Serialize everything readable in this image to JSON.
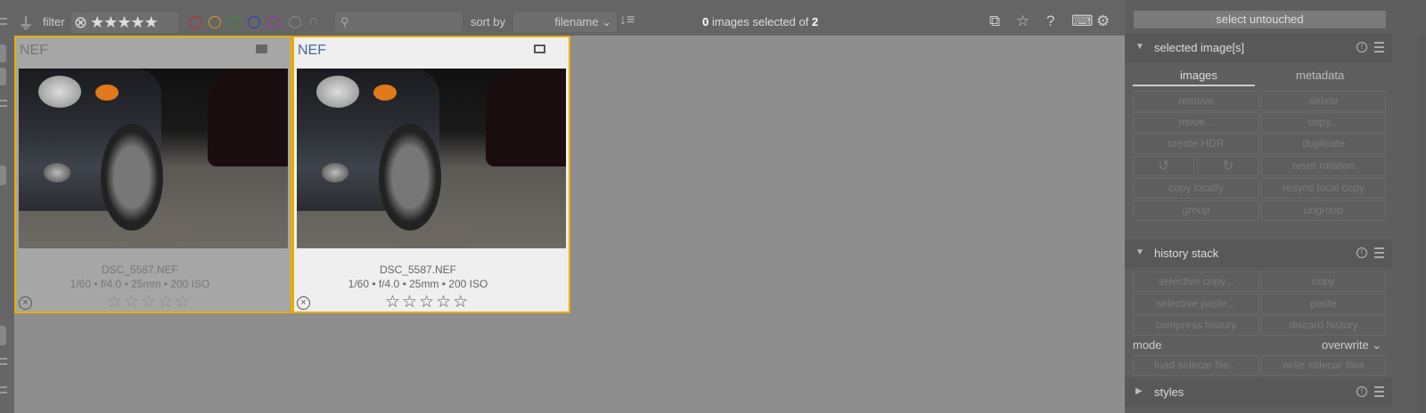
{
  "topbar": {
    "filter_label": "filter",
    "stars": "⊗ ★★★★★",
    "color_labels": [
      "#c62828",
      "#d49a1a",
      "#2e9e2e",
      "#2a3cc8",
      "#b02ab0",
      "#888888"
    ],
    "search_placeholder": "",
    "sort_by_label": "sort by",
    "sort_value": "filename",
    "selected_count": "0",
    "selected_text": " images selected of ",
    "total": "2"
  },
  "thumbnails": [
    {
      "ext": "NEF",
      "filename": "DSC_5587.NEF",
      "exif": "1/60 • f/4.0 • 25mm • 200 ISO",
      "rating": 0,
      "stars": "☆☆☆☆☆"
    },
    {
      "ext": "NEF",
      "filename": "DSC_5587.NEF",
      "exif": "1/60 • f/4.0 • 25mm • 200 ISO",
      "rating": 0,
      "stars": "☆☆☆☆☆"
    }
  ],
  "right": {
    "select_untouched": "select untouched",
    "selected_images": {
      "title": "selected image[s]",
      "tabs": [
        "images",
        "metadata"
      ],
      "buttons": [
        "remove",
        "delete",
        "move...",
        "copy...",
        "create HDR",
        "duplicate",
        "reset rotation",
        "copy locally",
        "resync local copy",
        "group",
        "ungroup"
      ]
    },
    "history_stack": {
      "title": "history stack",
      "buttons": [
        "selective copy...",
        "copy",
        "selective paste...",
        "paste",
        "compress history",
        "discard history"
      ],
      "mode_label": "mode",
      "mode_value": "overwrite",
      "sidecar": [
        "load sidecar file...",
        "write sidecar files"
      ]
    },
    "styles": {
      "title": "styles"
    }
  }
}
